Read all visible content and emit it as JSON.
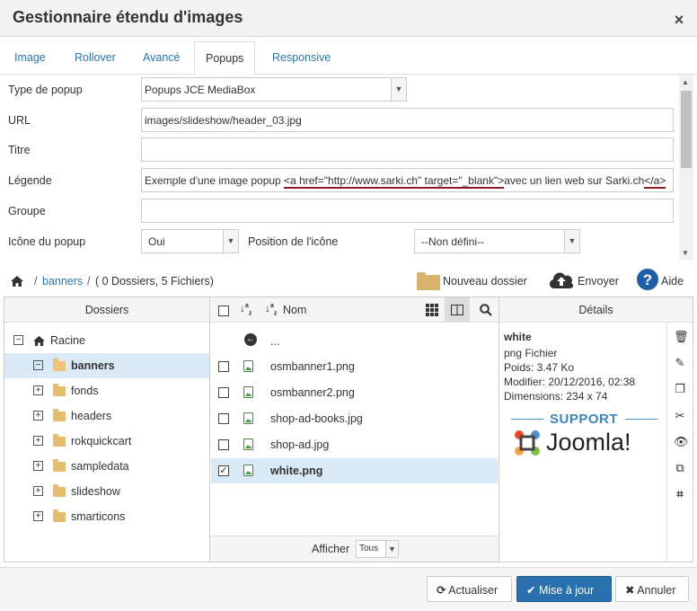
{
  "dialog": {
    "title": "Gestionnaire étendu d'images",
    "close": "×"
  },
  "tabs": [
    {
      "label": "Image"
    },
    {
      "label": "Rollover"
    },
    {
      "label": "Avancé"
    },
    {
      "label": "Popups"
    },
    {
      "label": "Responsive"
    }
  ],
  "form": {
    "popup_type": {
      "label": "Type de popup",
      "value": "Popups JCE MediaBox"
    },
    "url": {
      "label": "URL",
      "value": "images/slideshow/header_03.jpg"
    },
    "title": {
      "label": "Titre",
      "value": ""
    },
    "caption": {
      "label": "Légende",
      "text_before": "Exemple d'une image popup ",
      "link_open": "<a href=\"http://www.sarki.ch\" target=\"_blank\">",
      "link_text": "avec un lien web sur Sarki.ch",
      "link_close": "</a>"
    },
    "group": {
      "label": "Groupe",
      "value": ""
    },
    "icon": {
      "label": "Icône du popup",
      "value": "Oui"
    },
    "icon_position": {
      "label": "Position de l'icône",
      "value": "--Non défini--"
    }
  },
  "browser": {
    "breadcrumb": {
      "folder": "banners",
      "sep": "/",
      "summary": "( 0 Dossiers, 5 Fichiers)"
    },
    "new_folder": "Nouveau dossier",
    "upload": "Envoyer",
    "help": "Aide",
    "folders_header": "Dossiers",
    "name_header": "Nom",
    "details_header": "Détails",
    "root": "Racine",
    "folders": [
      {
        "name": "banners",
        "selected": true,
        "expanded": true
      },
      {
        "name": "fonds"
      },
      {
        "name": "headers"
      },
      {
        "name": "rokquickcart"
      },
      {
        "name": "sampledata"
      },
      {
        "name": "slideshow"
      },
      {
        "name": "smarticons"
      }
    ],
    "parent_dir": "...",
    "files": [
      {
        "name": "osmbanner1.png",
        "checked": false
      },
      {
        "name": "osmbanner2.png",
        "checked": false
      },
      {
        "name": "shop-ad-books.jpg",
        "checked": false
      },
      {
        "name": "shop-ad.jpg",
        "checked": false
      },
      {
        "name": "white.png",
        "checked": true
      }
    ],
    "show_label": "Afficher",
    "show_value": "Tous",
    "details": {
      "name": "white",
      "type": "png Fichier",
      "size": "Poids: 3.47 Ko",
      "modified": "Modifier: 20/12/2016, 02:38",
      "dimensions": "Dimensions: 234 x 74",
      "preview_support": "SUPPORT",
      "preview_brand": "Joomla!"
    }
  },
  "footer": {
    "refresh": "Actualiser",
    "update": "Mise à jour",
    "cancel": "Annuler"
  },
  "colors": {
    "accent": "#2a76b5",
    "primary_button": "#2a6fae",
    "selection": "#d9eaf6",
    "folder": "#e8bc6f",
    "highlight_underline": "#8a1c2b"
  }
}
